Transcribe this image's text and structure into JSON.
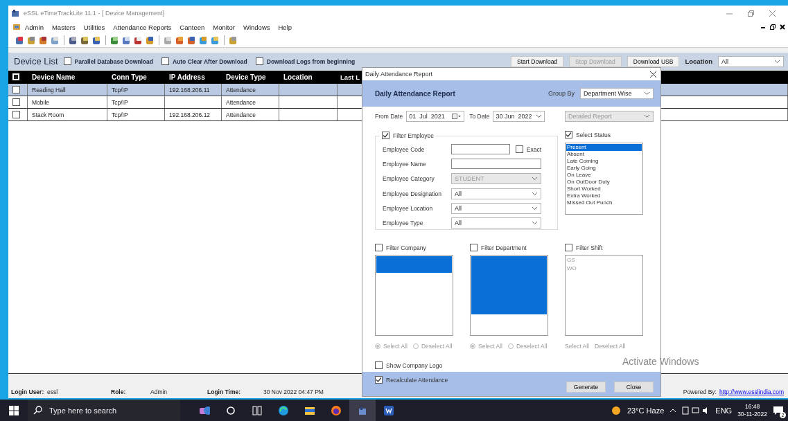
{
  "window": {
    "title": "eSSL eTimeTrackLite 11.1 - [ Device Management]"
  },
  "menu": [
    "Admin",
    "Masters",
    "Utilities",
    "Attendance Reports",
    "Canteen",
    "Monitor",
    "Windows",
    "Help"
  ],
  "device_list": {
    "title": "Device List",
    "options": [
      {
        "label": "Parallel Database Download",
        "checked": false
      },
      {
        "label": "Auto Clear After Download",
        "checked": false
      },
      {
        "label": "Download Logs from beginning",
        "checked": false
      }
    ],
    "buttons": [
      {
        "label": "Start Download",
        "disabled": false
      },
      {
        "label": "Stop Download",
        "disabled": true
      },
      {
        "label": "Download USB",
        "disabled": false
      }
    ],
    "location_label": "Location",
    "location_value": "All"
  },
  "table": {
    "columns": [
      "Device Name",
      "Conn Type",
      "IP Address",
      "Device Type",
      "Location",
      "Last L"
    ],
    "rows": [
      {
        "selected": true,
        "checked": false,
        "device_name": "Reading Hall",
        "conn_type": "Tcp/IP",
        "ip_address": "192.168.206.11",
        "device_type": "Attendance"
      },
      {
        "selected": false,
        "checked": false,
        "device_name": "Mobile",
        "conn_type": "Tcp/IP",
        "device_type": "Attendance"
      },
      {
        "selected": false,
        "checked": false,
        "device_name": "Stack Room",
        "conn_type": "Tcp/IP",
        "ip_address": "192.168.206.12",
        "device_type": "Attendance"
      }
    ]
  },
  "status_bar": {
    "items": [
      {
        "label": "Login User:",
        "value": "essl"
      },
      {
        "label": "Role:",
        "value": "Admin"
      },
      {
        "label": "Login Time:",
        "value": "30 Nov 2022 04:47 PM"
      }
    ],
    "powered_by_label": "Powered By:",
    "powered_by_link": "http://www.esslindia.com"
  },
  "watermark_text": "Activate Windows",
  "dialog": {
    "title": "Daily Attendance Report",
    "heading": "Daily Attendance Report",
    "group_by_label": "Group By",
    "group_by": "Department Wise",
    "from_label": "From Date",
    "from_date": "01  Jul  2021",
    "to_label": "To Date",
    "to_date": "30 Jun  2022",
    "report_type": "Detailed Report",
    "filter_employee": {
      "label": "Filter Employee",
      "checked": true
    },
    "fields": [
      {
        "kind": "text",
        "label": "Employee Code",
        "exact": {
          "label": "Exact",
          "checked": false
        }
      },
      {
        "kind": "text",
        "label": "Employee Name"
      },
      {
        "kind": "select",
        "label": "Employee Category",
        "value": "STUDENT",
        "disabled": true
      },
      {
        "kind": "select",
        "label": "Employee Designation",
        "value": "All",
        "disabled": false
      },
      {
        "kind": "select",
        "label": "Employee Location",
        "value": "All",
        "disabled": false
      },
      {
        "kind": "select",
        "label": "Employee Type",
        "value": "All",
        "disabled": false
      }
    ],
    "status": {
      "label": "Select Status",
      "checked": true,
      "items": [
        {
          "label": "Present",
          "selected": true
        },
        {
          "label": "Absent",
          "selected": false
        },
        {
          "label": "Late Coming",
          "selected": false
        },
        {
          "label": "Early Going",
          "selected": false
        },
        {
          "label": "On Leave",
          "selected": false
        },
        {
          "label": "On OutDoor Duty",
          "selected": false
        },
        {
          "label": "Short Worked",
          "selected": false
        },
        {
          "label": "Extra Worked",
          "selected": false
        },
        {
          "label": "Missed Out Punch",
          "selected": false
        }
      ]
    },
    "filters": [
      {
        "label": "Filter Company",
        "checked": false,
        "items": [
          {
            "selected": true
          },
          {
            "selected": true
          }
        ],
        "actions": [
          {
            "kind": "radio",
            "label": "Select All",
            "selected": true,
            "disabled": true
          },
          {
            "kind": "radio",
            "label": "Deselect All",
            "selected": false,
            "disabled": true
          }
        ]
      },
      {
        "label": "Filter Department",
        "checked": false,
        "items": [
          {
            "selected": true
          },
          {
            "selected": true
          },
          {
            "selected": true
          },
          {
            "selected": true
          },
          {
            "selected": true
          },
          {
            "selected": true
          },
          {
            "selected": true
          }
        ],
        "actions": [
          {
            "kind": "radio",
            "label": "Select All",
            "selected": true,
            "disabled": true
          },
          {
            "kind": "radio",
            "label": "Deselect All",
            "selected": false,
            "disabled": true
          }
        ]
      },
      {
        "label": "Filter Shift",
        "checked": false,
        "items": [
          {
            "label": "GS",
            "selected": false
          },
          {
            "label": "WO",
            "selected": false
          }
        ],
        "actions": [
          {
            "kind": "link",
            "label": "Select All"
          },
          {
            "kind": "link",
            "label": "Deselect All"
          }
        ]
      }
    ],
    "show_company_logo": {
      "label": "Show Company Logo",
      "checked": false
    },
    "recalculate": {
      "label": "Recalculate Attendance",
      "checked": true
    },
    "buttons": [
      "Generate",
      "Close"
    ]
  },
  "taskbar": {
    "search_placeholder": "Type here to search",
    "weather": "23°C  Haze",
    "language": "ENG",
    "time": "16:48",
    "date": "30-11-2022",
    "notification_count": "2"
  }
}
